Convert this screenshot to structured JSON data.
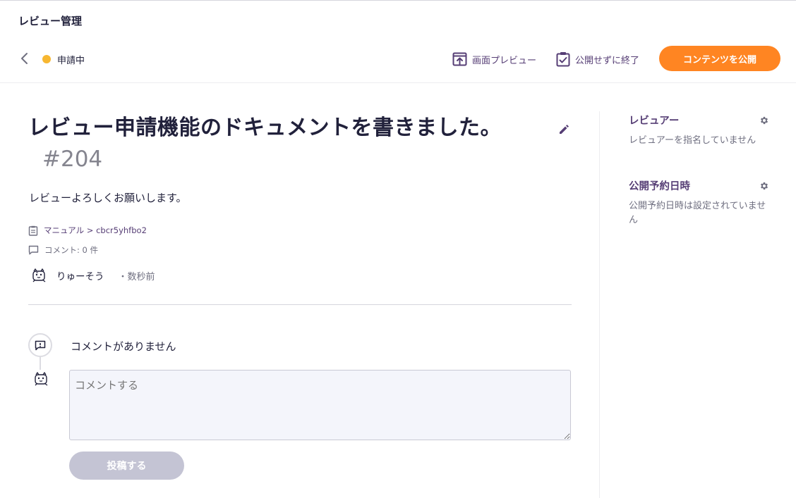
{
  "app": {
    "title": "レビュー管理"
  },
  "header": {
    "status_label": "申請中",
    "status_color": "#f7b731",
    "preview_label": "画面プレビュー",
    "close_label": "公開せずに終了",
    "publish_label": "コンテンツを公開",
    "accent_color": "#ff8522"
  },
  "review": {
    "title": "レビュー申請機能のドキュメントを書きました。",
    "number": "#204",
    "description": "レビューよろしくお願いします。",
    "path": "マニュアル > cbcr5yhfbo2",
    "comment_count": "コメント: 0 件",
    "author": "りゅーそう",
    "time": "・数秒前"
  },
  "comments": {
    "empty_message": "コメントがありません",
    "placeholder": "コメントする",
    "post_label": "投稿する"
  },
  "sidebar": {
    "reviewer": {
      "title": "レビュアー",
      "value": "レビュアーを指名していません"
    },
    "schedule": {
      "title": "公開予約日時",
      "value": "公開予約日時は設定されていません"
    }
  }
}
